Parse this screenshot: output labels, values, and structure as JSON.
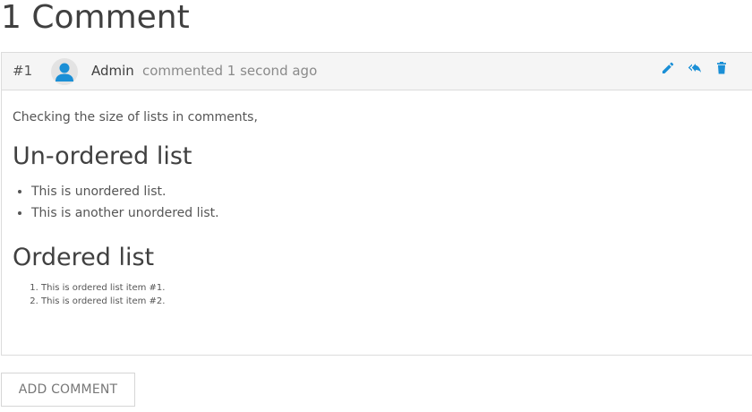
{
  "page": {
    "title": "1 Comment"
  },
  "comment": {
    "number": "#1",
    "author": "Admin",
    "meta": "commented 1 second ago",
    "actions": [
      {
        "name": "edit",
        "icon": "pencil-icon"
      },
      {
        "name": "reply",
        "icon": "reply-all-icon"
      },
      {
        "name": "delete",
        "icon": "trash-icon"
      }
    ],
    "body": {
      "intro": "Checking the size of lists in comments,",
      "unordered_heading": "Un-ordered list",
      "unordered_items": [
        "This is unordered list.",
        "This is another unordered list."
      ],
      "ordered_heading": "Ordered list",
      "ordered_items": [
        "This is ordered list item #1.",
        "This is ordered list item #2."
      ]
    }
  },
  "add_comment_label": "ADD COMMENT",
  "colors": {
    "accent": "#1a8fd6",
    "text": "#404040",
    "muted": "#8a8a8a",
    "header_bg": "#f5f5f5",
    "border": "#dcdcdc"
  }
}
